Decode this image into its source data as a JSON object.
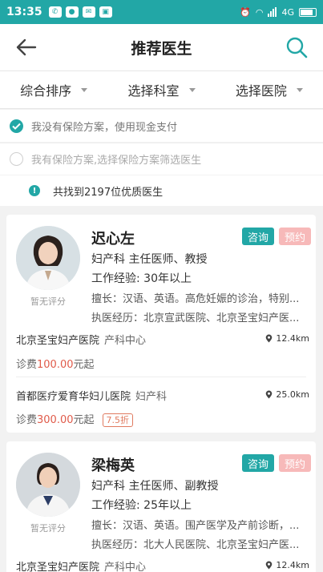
{
  "status_bar": {
    "time": "13:35",
    "network": "4G",
    "notifications": [
      "wechat-icon",
      "chat-icon",
      "mail-icon",
      "app-icon"
    ]
  },
  "header": {
    "title": "推荐医生",
    "back_icon": "arrow-left-icon",
    "search_icon": "search-icon"
  },
  "filters": [
    {
      "label": "综合排序"
    },
    {
      "label": "选择科室"
    },
    {
      "label": "选择医院"
    }
  ],
  "payment_options": [
    {
      "label": "我没有保险方案，使用现金支付",
      "checked": true
    },
    {
      "label": "我有保险方案,选择保险方案筛选医生",
      "checked": false
    }
  ],
  "result_text": "共找到2197位优质医生",
  "colors": {
    "accent": "#22a7a6",
    "fee": "#e05b4a",
    "booking": "#f7b9b9"
  },
  "doctors": [
    {
      "name": "迟心左",
      "title": "妇产科   主任医师、教授",
      "experience": "工作经验:    30年以上",
      "specialty": "擅长：汉语、英语。高危妊娠的诊治，特别...",
      "history": "执医经历：北京宣武医院、北京圣宝妇产医...",
      "rating": "暂无评分",
      "consult_label": "咨询",
      "book_label": "预约",
      "hospitals": [
        {
          "name": "北京圣宝妇产医院",
          "dept": "产科中心",
          "distance": "12.4km",
          "fee_prefix": "诊费",
          "fee_amount": "100.00",
          "fee_suffix": "元起",
          "discount": ""
        },
        {
          "name": "首都医疗爱育华妇儿医院",
          "dept": "妇产科",
          "distance": "25.0km",
          "fee_prefix": "诊费",
          "fee_amount": "300.00",
          "fee_suffix": "元起",
          "discount": "7.5折"
        }
      ]
    },
    {
      "name": "梁梅英",
      "title": "妇产科   主任医师、副教授",
      "experience": "工作经验:    25年以上",
      "specialty": "擅长：汉语、英语。围产医学及产前诊断，...",
      "history": "执医经历：北大人民医院、北京圣宝妇产医...",
      "rating": "暂无评分",
      "consult_label": "咨询",
      "book_label": "预约",
      "hospitals": [
        {
          "name": "北京圣宝妇产医院",
          "dept": "产科中心",
          "distance": "12.4km"
        }
      ]
    }
  ]
}
